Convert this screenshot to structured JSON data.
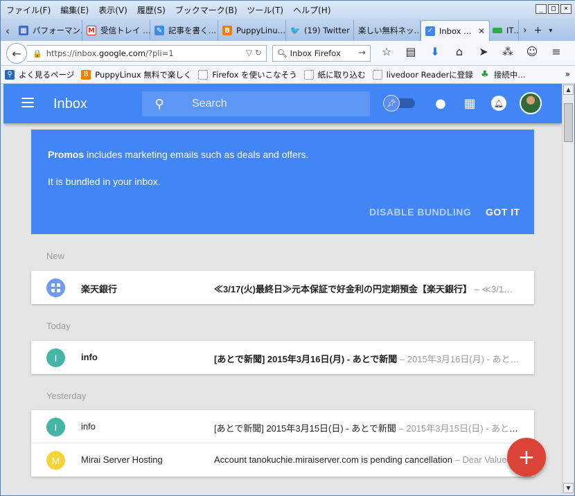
{
  "menubar": {
    "items": [
      "ファイル(F)",
      "編集(E)",
      "表示(V)",
      "履歴(S)",
      "ブックマーク(B)",
      "ツール(T)",
      "ヘルプ(H)"
    ],
    "window_controls": [
      "_",
      "□",
      "×"
    ]
  },
  "tabs": [
    {
      "label": "パフォーマン…",
      "icon": "page-icon",
      "color": "#3c6fbf"
    },
    {
      "label": "受信トレイ …",
      "icon": "gmail-icon",
      "color": "#d93025"
    },
    {
      "label": "記事を書く…",
      "icon": "pen-icon",
      "color": "#3a8ee6"
    },
    {
      "label": "PuppyLinu…",
      "icon": "blogger-icon",
      "color": "#f57d00"
    },
    {
      "label": "(19) Twitter",
      "icon": "twitter-icon",
      "color": "#1da1f2"
    },
    {
      "label": "楽しい無料ネッ…",
      "icon": "none",
      "color": ""
    },
    {
      "label": "Inbox …",
      "icon": "inbox-icon",
      "color": "#4285f4",
      "active": true
    },
    {
      "label": "IT…",
      "icon": "green-icon",
      "color": "#2eaa48"
    }
  ],
  "navbar": {
    "url_prefix": "https://inbox.",
    "url_domain": "google.com",
    "url_suffix": "/?pli=1",
    "search_engine_text": "Inbox Firefox"
  },
  "bookmarks": [
    {
      "label": "よく見るページ",
      "icon": "bookmarks-icon"
    },
    {
      "label": "PuppyLinux 無料で楽しく",
      "icon": "blogger-icon"
    },
    {
      "label": "Firefox を使いこなそう",
      "icon": "dotted-page-icon"
    },
    {
      "label": "紙に取り込む",
      "icon": "dotted-page-icon"
    },
    {
      "label": "livedoor Readerに登録",
      "icon": "dotted-page-icon"
    },
    {
      "label": "接続中…",
      "icon": "clover-icon"
    }
  ],
  "app": {
    "title": "Inbox",
    "search_placeholder": "Search"
  },
  "promo": {
    "bold": "Promos",
    "line1_rest": " includes marketing emails such as deals and offers.",
    "line2": "It is bundled in your inbox.",
    "disable_label": "DISABLE BUNDLING",
    "gotit_label": "GOT IT"
  },
  "sections": [
    {
      "label": "New",
      "rows": [
        {
          "avatar": "",
          "avatar_icon": "bundle-icon",
          "color": "#6f9cf2",
          "sender": "楽天銀行",
          "subject": "≪3/17(火)最終日≫元本保証で好金利の円定期預金【楽天銀行】",
          "snippet": " – ≪3/1…",
          "unread": true
        }
      ]
    },
    {
      "label": "Today",
      "rows": [
        {
          "avatar": "I",
          "color": "#45b5a5",
          "sender": "info",
          "subject": "[あとで新聞] 2015年3月16日(月) - あとで新聞",
          "snippet": " – 2015年3月16日(月) - あと…",
          "unread": true
        }
      ]
    },
    {
      "label": "Yesterday",
      "rows": [
        {
          "avatar": "I",
          "color": "#45b5a5",
          "sender": "info",
          "subject": "[あとで新聞] 2015年3月15日(日) - あとで新聞",
          "snippet": " – 2015年3月15日(日) - あとで…",
          "unread": false
        },
        {
          "avatar": "M",
          "color": "#f7d337",
          "sender": "Mirai Server Hosting",
          "subject": "Account tanokuchie.miraiserver.com is pending cancellation",
          "snippet": " – Dear Valued",
          "unread": false
        }
      ]
    }
  ],
  "fab_label": "+",
  "colors": {
    "app_blue": "#4285f4",
    "fab_red": "#db4437"
  }
}
